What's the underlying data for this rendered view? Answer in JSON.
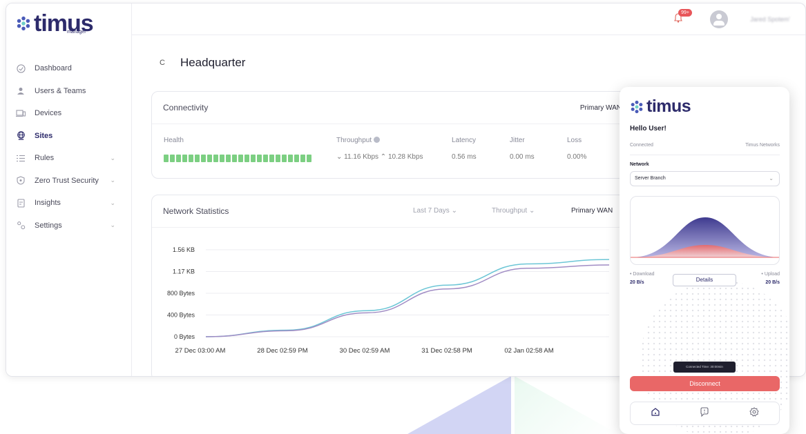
{
  "app": {
    "logo_text": "timus",
    "logo_sub": "manager"
  },
  "sidebar": {
    "items": [
      {
        "label": "Dashboard",
        "icon": "dashboard-icon"
      },
      {
        "label": "Users & Teams",
        "icon": "user-icon"
      },
      {
        "label": "Devices",
        "icon": "devices-icon"
      },
      {
        "label": "Sites",
        "icon": "globe-icon",
        "active": true
      },
      {
        "label": "Rules",
        "icon": "list-icon"
      },
      {
        "label": "Zero Trust Security",
        "icon": "shield-icon"
      },
      {
        "label": "Insights",
        "icon": "document-icon"
      },
      {
        "label": "Settings",
        "icon": "gear-icon"
      }
    ]
  },
  "topbar": {
    "notif_count": "99+",
    "username": "Jared Spotem'"
  },
  "page": {
    "back": "C",
    "title": "Headquarter"
  },
  "connectivity": {
    "title": "Connectivity",
    "wan": "Primary WAN",
    "health_label": "Health",
    "health_segments": 24,
    "throughput_label": "Throughput",
    "throughput_value": "⌄ 11.16 Kbps ⌃ 10.28 Kbps",
    "latency_label": "Latency",
    "latency_value": "0.56 ms",
    "jitter_label": "Jitter",
    "jitter_value": "0.00 ms",
    "loss_label": "Loss",
    "loss_value": "0.00%"
  },
  "stats": {
    "title": "Network Statistics",
    "range": "Last 7 Days",
    "metric": "Throughput",
    "wan": "Primary WAN"
  },
  "chart_data": {
    "type": "line",
    "x": [
      "27 Dec 03:00 AM",
      "28 Dec 02:59 PM",
      "30 Dec 02:59 AM",
      "31 Dec 02:58 PM",
      "02 Jan 02:58 AM"
    ],
    "y_ticks": [
      "1.56 KB",
      "1.17 KB",
      "800 Bytes",
      "400 Bytes",
      "0 Bytes"
    ],
    "ylim": [
      0,
      1600
    ],
    "series": [
      {
        "color": "#6cc6d6",
        "values": [
          0,
          120,
          480,
          950,
          1340,
          1420
        ]
      },
      {
        "color": "#a08cc4",
        "values": [
          0,
          110,
          440,
          880,
          1260,
          1320
        ]
      }
    ]
  },
  "client": {
    "logo_text": "timus",
    "hello": "Hello User!",
    "status": "Connected",
    "provider": "Timus Networks",
    "network_label": "Network",
    "network_value": "Server Branch",
    "download_label": "• Download",
    "download_value": "20 B/s",
    "upload_label": "• Upload",
    "upload_value": "20 B/s",
    "details": "Details",
    "connected_time": "Connected Time: 30:00min",
    "disconnect": "Disconnect"
  }
}
